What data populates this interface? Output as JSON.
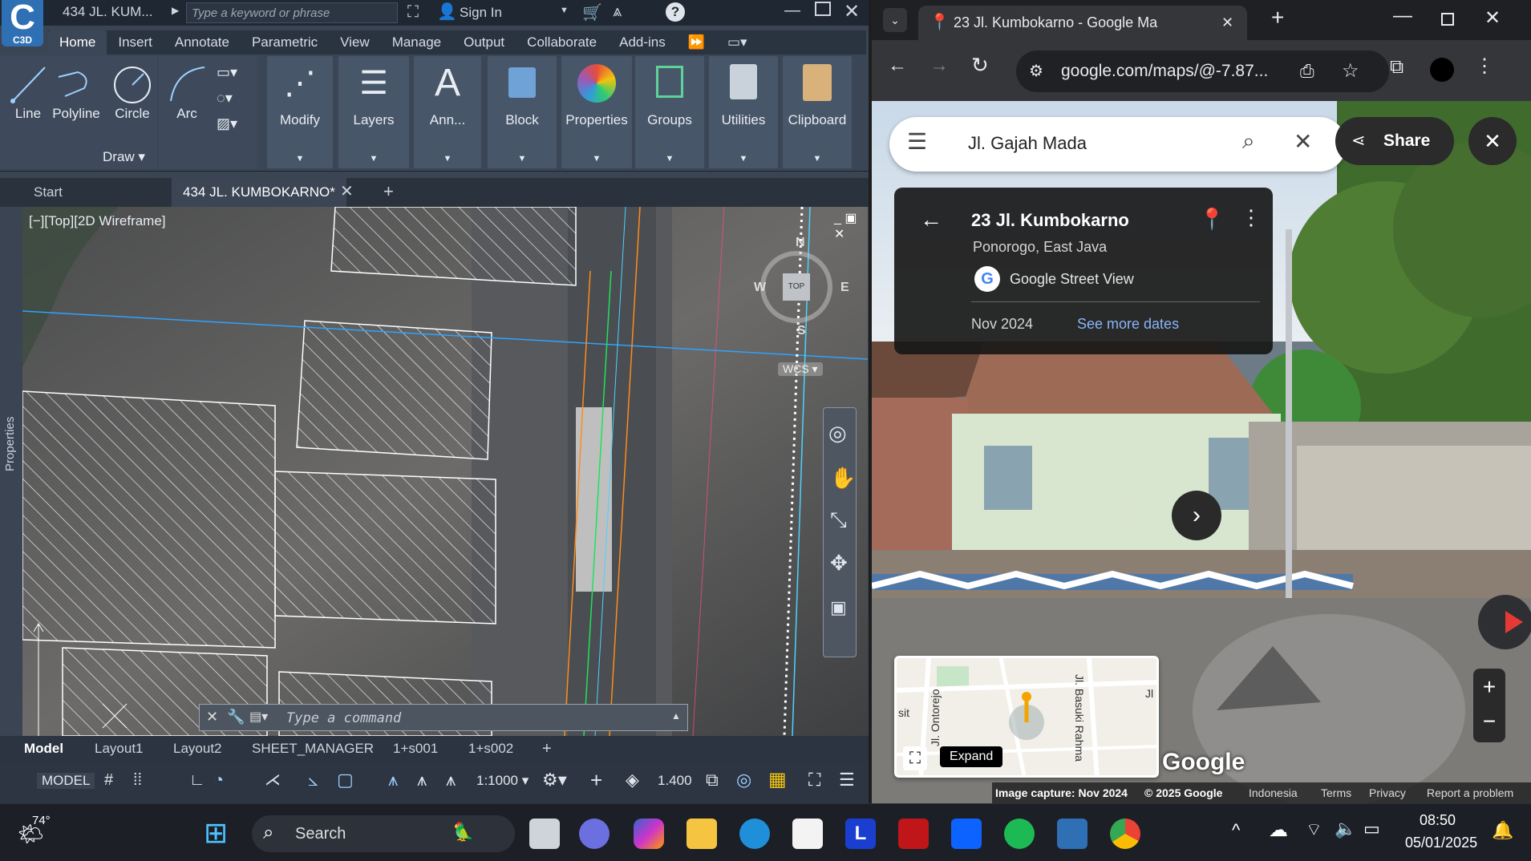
{
  "cad": {
    "title": "434 JL. KUM...",
    "search_placeholder": "Type a keyword or phrase",
    "sign_in": "Sign In",
    "logo_text": "C3D",
    "menu_tabs": [
      "Home",
      "Insert",
      "Annotate",
      "Parametric",
      "View",
      "Manage",
      "Output",
      "Collaborate",
      "Add-ins"
    ],
    "draw_items": [
      "Line",
      "Polyline",
      "Circle",
      "Arc"
    ],
    "draw_panel_label": "Draw",
    "panels": [
      "Modify",
      "Layers",
      "Ann...",
      "Block",
      "Properties",
      "Groups",
      "Utilities",
      "Clipboard"
    ],
    "doc_tabs": [
      "Start",
      "434 JL. KUMBOKARNO*"
    ],
    "viewport_label": "[−][Top][2D Wireframe]",
    "side_label": "Properties",
    "viewcube": {
      "top": "TOP",
      "n": "N",
      "s": "S",
      "e": "E",
      "w": "W",
      "wcs": "WCS"
    },
    "command_placeholder": "Type a command",
    "layout_tabs": [
      "Model",
      "Layout1",
      "Layout2",
      "SHEET_MANAGER",
      "1+s001",
      "1+s002"
    ],
    "status": {
      "model": "MODEL",
      "scale": "1:1000",
      "value": "1.400"
    }
  },
  "chrome": {
    "tab_title": "23 Jl. Kumbokarno - Google Ma",
    "url": "google.com/maps/@-7.87...",
    "search_value": "Jl. Gajah Mada",
    "share_label": "Share",
    "place": {
      "name": "23 Jl. Kumbokarno",
      "region": "Ponorogo, East Java",
      "source": "Google Street View",
      "date": "Nov 2024",
      "more_dates": "See more dates"
    },
    "minimap": {
      "expand_label": "Expand",
      "road1": "Jl. Basuki Rahma",
      "road2": "Jl. Ontorejo",
      "road3": "Jl",
      "frag": "sit"
    },
    "google_logo": "Google",
    "footer": [
      "Image capture: Nov 2024",
      "© 2025 Google",
      "Indonesia",
      "Terms",
      "Privacy",
      "Report a problem"
    ]
  },
  "taskbar": {
    "temp": "74°",
    "search": "Search",
    "time": "08:50",
    "date": "05/01/2025"
  }
}
